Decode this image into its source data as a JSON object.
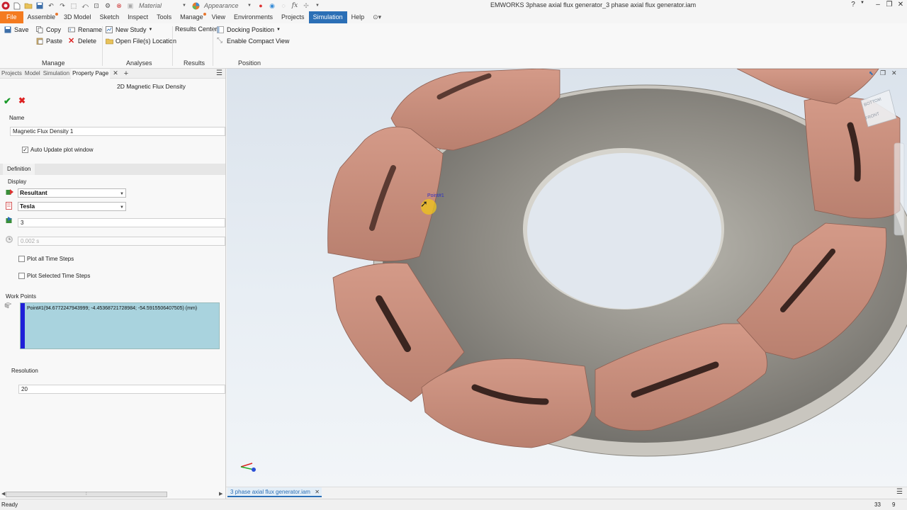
{
  "titlebar": {
    "material_placeholder": "Material",
    "appearance_placeholder": "Appearance",
    "fx_label": "fx",
    "app_title": "EMWORKS   3phase axial flux generator_3 phase axial flux generator.iam"
  },
  "menu": {
    "tabs": [
      "File",
      "Assemble",
      "3D Model",
      "Sketch",
      "Inspect",
      "Tools",
      "Manage",
      "View",
      "Environments",
      "Projects",
      "Simulation",
      "Help"
    ],
    "active": "Simulation"
  },
  "ribbon": {
    "manage": {
      "save": "Save",
      "copy": "Copy",
      "paste": "Paste",
      "rename": "Rename",
      "delete": "Delete",
      "label": "Manage"
    },
    "analyses": {
      "new_study": "New Study",
      "open_location": "Open File(s) Location",
      "label": "Analyses"
    },
    "results": {
      "results_center": "Results Center",
      "label": "Results"
    },
    "position": {
      "docking": "Docking Position",
      "compact": "Enable Compact View",
      "label": "Position"
    }
  },
  "panel": {
    "tabs": [
      "Projects",
      "Model",
      "Simulation",
      "Property Page"
    ],
    "title": "2D Magnetic Flux Density",
    "name_label": "Name",
    "name_value": "Magnetic Flux Density 1",
    "auto_update_label": "Auto Update plot window",
    "definition_tab": "Definition",
    "display_label": "Display",
    "component_value": "Resultant",
    "unit_value": "Tesla",
    "step_value": "3",
    "time_value": "0.002 s",
    "plot_all_label": "Plot all Time Steps",
    "plot_selected_label": "Plot Selected Time Steps",
    "work_points_label": "Work Points",
    "work_point_value": "Point#1(94.6772247943999; -4.45368721728984; -54.5915506407505) (mm)",
    "resolution_label": "Resolution",
    "resolution_value": "20"
  },
  "viewport": {
    "point_label": "Point#1",
    "viewcube_top": "BOTTOM",
    "viewcube_front": "FRONT"
  },
  "document_tab": "3 phase axial flux generator.iam",
  "status": {
    "left": "Ready",
    "count1": "33",
    "count2": "9"
  }
}
